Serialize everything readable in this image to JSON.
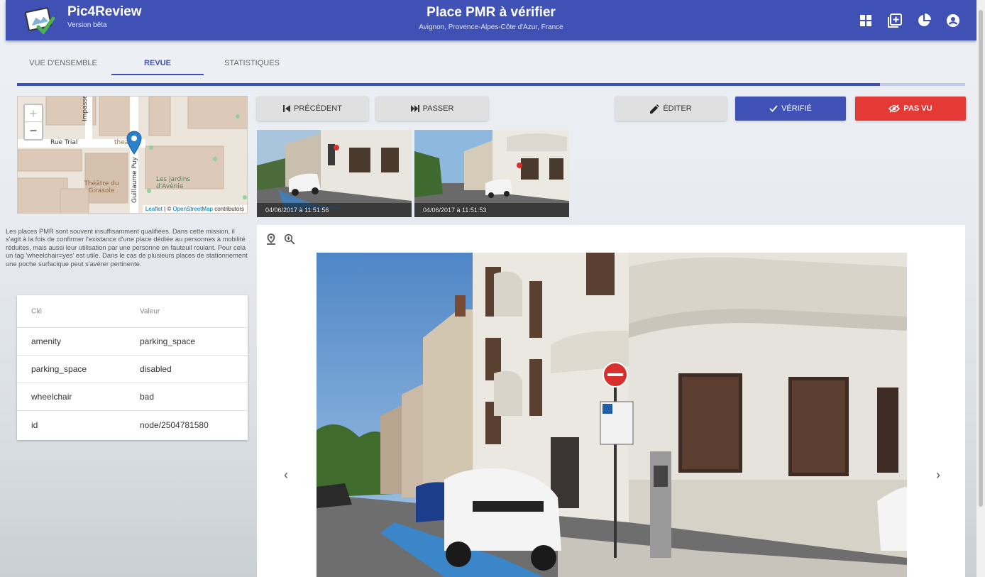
{
  "app": {
    "name": "Pic4Review",
    "version": "Version bêta"
  },
  "mission": {
    "title": "Place PMR à vérifier",
    "location": "Avignon, Provence-Alpes-Côte d'Azur, France"
  },
  "top_icons": [
    "grid-icon",
    "add-box-icon",
    "pie-chart-icon",
    "account-circle-icon"
  ],
  "tabs": [
    {
      "label": "VUE D'ENSEMBLE",
      "active": false
    },
    {
      "label": "REVUE",
      "active": true
    },
    {
      "label": "STATISTIQUES",
      "active": false
    }
  ],
  "progress": {
    "fraction": 0.91
  },
  "map": {
    "zoom_in": "+",
    "zoom_out": "−",
    "streets": [
      "Rue Trial",
      "Impasse Trial",
      "Guillaume Puy"
    ],
    "pois": [
      "theat",
      "Théâtre du Girasole",
      "Les jardins d'Avènie"
    ],
    "attribution": {
      "leaflet": "Leaflet",
      "sep": " | © ",
      "osm": "OpenStreetMap",
      "rest": " contributors"
    }
  },
  "description": "Les places PMR sont souvent insuffisamment qualifiées. Dans cette mission, il s'agit à la fois de confirmer l'existance d'une place dédiée au personnes à mobilité réduites, mais aussi leur utilisation par une personne en fauteuil roulant. Pour cela un tag 'wheelchair=yes' est utile. Dans le cas de plusieurs places de stationnement une poche surfacique peut s'avérer pertinente.",
  "tags_table": {
    "headers": {
      "key": "Clé",
      "value": "Valeur"
    },
    "rows": [
      {
        "key": "amenity",
        "value": "parking_space"
      },
      {
        "key": "parking_space",
        "value": "disabled"
      },
      {
        "key": "wheelchair",
        "value": "bad"
      },
      {
        "key": "id",
        "value": "node/2504781580"
      }
    ]
  },
  "actions": {
    "previous": "PRÉCÉDENT",
    "skip": "PASSER",
    "edit": "ÉDITER",
    "verified": "VÉRIFIÉ",
    "not_seen": "PAS VU"
  },
  "thumbnails": [
    {
      "timestamp": "04/06/2017 à 11:51:56"
    },
    {
      "timestamp": "04/06/2017 à 11:51:53"
    }
  ],
  "viewer": {
    "prev": "‹",
    "next": "›"
  },
  "colors": {
    "primary": "#3f51b5",
    "danger": "#e53935",
    "button_grey": "#e0e0e0"
  }
}
